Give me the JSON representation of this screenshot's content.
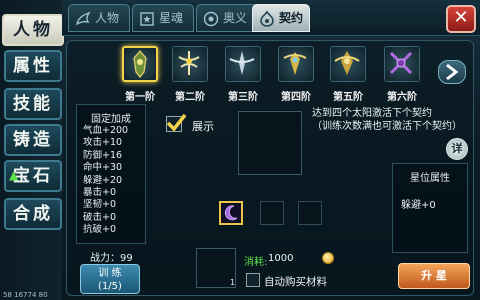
{
  "sidebar": {
    "items": [
      {
        "label": "人物",
        "active": true
      },
      {
        "label": "属性"
      },
      {
        "label": "技能"
      },
      {
        "label": "铸造"
      },
      {
        "label": "宝石",
        "badge_icon": "green-up-arrow"
      },
      {
        "label": "合成"
      }
    ],
    "footer_code": "58 16774 80"
  },
  "tabs": [
    {
      "label": "人物",
      "icon": "dragon-icon"
    },
    {
      "label": "星魂",
      "icon": "star-soul-icon"
    },
    {
      "label": "奥义",
      "icon": "mystic-eye-icon"
    },
    {
      "label": "契约",
      "icon": "contract-icon",
      "active": true
    }
  ],
  "close_icon": "close-x-icon",
  "stages": [
    {
      "label": "第一阶",
      "selected": true,
      "icon": "stage-1-emblem-icon"
    },
    {
      "label": "第二阶",
      "icon": "stage-2-emblem-icon"
    },
    {
      "label": "第三阶",
      "icon": "stage-3-emblem-icon"
    },
    {
      "label": "第四阶",
      "icon": "stage-4-emblem-icon"
    },
    {
      "label": "第五阶",
      "icon": "stage-5-emblem-icon"
    },
    {
      "label": "第六阶",
      "icon": "stage-6-emblem-icon"
    }
  ],
  "fixed_bonus": {
    "title": "固定加成",
    "stats": [
      "气血+200",
      "攻击+10",
      "防御+16",
      "命中+30",
      "躲避+20",
      "暴击+0",
      "坚韧+0",
      "破击+0",
      "抗破+0"
    ]
  },
  "power": "战力：99",
  "train_button": {
    "label": "训 练",
    "count": "(1/5)"
  },
  "show_toggle": {
    "label": "展示",
    "checked": true
  },
  "description": "达到四个太阳激活下个契约\n（训练次数满也可激活下个契约）",
  "detail_button": "详",
  "star_attributes": {
    "title": "星位属性",
    "value": "躲避+0"
  },
  "material": {
    "count": "1"
  },
  "cost": {
    "label": "消耗:",
    "value": "1000"
  },
  "auto_buy": {
    "label": "自动购买材料",
    "checked": false
  },
  "upgrade_button": "升 星",
  "colors": {
    "accent_gold": "#f2d14a",
    "cost_green": "#5fe04a",
    "upgrade_orange": "#e07a30",
    "close_red": "#c7342c"
  }
}
